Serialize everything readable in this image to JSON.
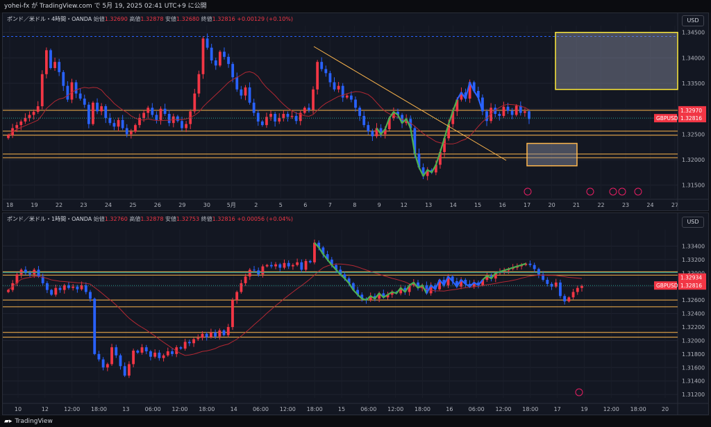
{
  "header": {
    "caption": "yohei-fx が TradingView.com で 5月 19, 2025 02:41 UTC+9 に公開"
  },
  "footer": {
    "brand": "TradingView"
  },
  "colors": {
    "up": "#f23645",
    "down": "#2962ff",
    "zone": "#ffb74d",
    "wave_green": "#4caf50",
    "wave_blue": "#2962ff",
    "ma": "#b22833",
    "price_tag": "#f23645"
  },
  "chart_data": [
    {
      "type": "candlestick",
      "pane": "top",
      "legend": {
        "symbol": "ポンド／米ドル・4時間・OANDA",
        "open_label": "始値",
        "open": "1.32690",
        "high_label": "高値",
        "high": "1.32878",
        "low_label": "安値",
        "low": "1.32680",
        "close_label": "終値",
        "close": "1.32816",
        "change": "+0.00129 (+0.10%)"
      },
      "currency": "USD",
      "ylim": [
        1.3125,
        1.3455
      ],
      "y_ticks": [
        "1.34500",
        "1.34000",
        "1.33500",
        "1.33000",
        "1.32500",
        "1.32000",
        "1.31500"
      ],
      "x_ticks": [
        "18",
        "19",
        "22",
        "23",
        "24",
        "25",
        "26",
        "29",
        "30",
        "5月",
        "2",
        "5",
        "6",
        "7",
        "8",
        "9",
        "12",
        "13",
        "14",
        "15",
        "16",
        "17",
        "20",
        "21",
        "22",
        "23",
        "24",
        "27"
      ],
      "price_labels": [
        {
          "label": "",
          "value": "1.32970"
        },
        {
          "label": "GBPUSD",
          "value": "1.32816"
        }
      ],
      "levels": [
        1.3297,
        1.3256,
        1.3248,
        1.3211,
        1.3204
      ],
      "closes": [
        1.3248,
        1.3262,
        1.3268,
        1.3275,
        1.3282,
        1.3288,
        1.3294,
        1.3305,
        1.3368,
        1.3415,
        1.338,
        1.3392,
        1.3372,
        1.3345,
        1.3318,
        1.3352,
        1.333,
        1.332,
        1.3308,
        1.327,
        1.3312,
        1.3295,
        1.3305,
        1.3282,
        1.3272,
        1.3265,
        1.3278,
        1.3262,
        1.325,
        1.3255,
        1.3268,
        1.3282,
        1.3292,
        1.3302,
        1.3288,
        1.3278,
        1.33,
        1.329,
        1.3272,
        1.3285,
        1.3276,
        1.3262,
        1.327,
        1.3295,
        1.333,
        1.3368,
        1.3438,
        1.342,
        1.3395,
        1.3385,
        1.3412,
        1.3402,
        1.3388,
        1.3362,
        1.3338,
        1.3326,
        1.3342,
        1.3312,
        1.3292,
        1.3275,
        1.3268,
        1.3284,
        1.329,
        1.3275,
        1.3282,
        1.329,
        1.3284,
        1.3286,
        1.3276,
        1.3292,
        1.3302,
        1.3298,
        1.3338,
        1.3392,
        1.3378,
        1.337,
        1.3352,
        1.3338,
        1.3345,
        1.3322,
        1.3326,
        1.3318,
        1.3302,
        1.3286,
        1.3268,
        1.3256,
        1.3246,
        1.3262,
        1.325,
        1.326,
        1.3282,
        1.3294,
        1.3288,
        1.3272,
        1.328,
        1.3262,
        1.3212,
        1.3185,
        1.3168,
        1.318,
        1.3175,
        1.319,
        1.3215,
        1.3242,
        1.327,
        1.3295,
        1.3318,
        1.3332,
        1.332,
        1.3352,
        1.3335,
        1.3322,
        1.3295,
        1.3276,
        1.3302,
        1.329,
        1.3286,
        1.3304,
        1.3296,
        1.3288,
        1.3306,
        1.3292,
        1.3295,
        1.328
      ],
      "annotations": [
        "trendline",
        "green wave",
        "blue wave",
        "supply zone box",
        "demand zone box"
      ],
      "events": [
        "17",
        "21",
        "22",
        "23",
        "24"
      ]
    },
    {
      "type": "candlestick",
      "pane": "bottom",
      "legend": {
        "symbol": "ポンド／米ドル・1時間・OANDA",
        "open_label": "始値",
        "open": "1.32760",
        "high_label": "高値",
        "high": "1.32878",
        "low_label": "安値",
        "low": "1.32753",
        "close_label": "終値",
        "close": "1.32816",
        "change": "+0.00056 (+0.04%)"
      },
      "currency": "USD",
      "ylim": [
        1.3115,
        1.3358
      ],
      "y_ticks": [
        "1.33400",
        "1.33200",
        "1.33000",
        "1.32800",
        "1.32600",
        "1.32400",
        "1.32200",
        "1.32000",
        "1.31800",
        "1.31600",
        "1.31400",
        "1.31200"
      ],
      "x_ticks": [
        "10",
        "12",
        "12:00",
        "18:00",
        "13",
        "06:00",
        "12:00",
        "18:00",
        "14",
        "06:00",
        "12:00",
        "18:00",
        "15",
        "06:00",
        "12:00",
        "18:00",
        "16",
        "06:00",
        "12:00",
        "18:00",
        "17",
        "19",
        "12:00",
        "18:00",
        "20"
      ],
      "price_labels": [
        {
          "label": "",
          "value": "1.32934"
        },
        {
          "label": "GBPUSD",
          "value": "1.32816"
        }
      ],
      "levels": [
        1.3302,
        1.3297,
        1.326,
        1.325,
        1.3212,
        1.3205
      ],
      "closes": [
        1.3275,
        1.3285,
        1.3298,
        1.3305,
        1.33,
        1.3298,
        1.3305,
        1.3295,
        1.3285,
        1.3275,
        1.3268,
        1.3278,
        1.3275,
        1.3282,
        1.3278,
        1.328,
        1.3276,
        1.3282,
        1.3272,
        1.3262,
        1.318,
        1.3172,
        1.316,
        1.3165,
        1.319,
        1.3178,
        1.3162,
        1.3148,
        1.3165,
        1.3185,
        1.3182,
        1.319,
        1.3184,
        1.3176,
        1.3182,
        1.3174,
        1.3178,
        1.3184,
        1.318,
        1.319,
        1.3188,
        1.3198,
        1.3196,
        1.3202,
        1.3204,
        1.321,
        1.3205,
        1.3212,
        1.3206,
        1.3215,
        1.3208,
        1.322,
        1.326,
        1.3272,
        1.3285,
        1.3295,
        1.3305,
        1.3304,
        1.3298,
        1.331,
        1.3312,
        1.331,
        1.3313,
        1.3308,
        1.3315,
        1.331,
        1.3312,
        1.3316,
        1.3305,
        1.3318,
        1.3316,
        1.3345,
        1.3338,
        1.3328,
        1.332,
        1.3312,
        1.3305,
        1.3298,
        1.3292,
        1.3285,
        1.3275,
        1.3268,
        1.3262,
        1.326,
        1.3266,
        1.3262,
        1.327,
        1.3264,
        1.3268,
        1.3272,
        1.327,
        1.3278,
        1.3272,
        1.3282,
        1.3286,
        1.3278,
        1.3282,
        1.327,
        1.3282,
        1.3276,
        1.329,
        1.3282,
        1.3295,
        1.3288,
        1.328,
        1.329,
        1.3284,
        1.328,
        1.3286,
        1.3282,
        1.329,
        1.3296,
        1.3292,
        1.33,
        1.3302,
        1.3304,
        1.3306,
        1.3308,
        1.331,
        1.3312,
        1.3314,
        1.3312,
        1.3306,
        1.3298,
        1.329,
        1.3284,
        1.328,
        1.3286,
        1.3266,
        1.3258,
        1.3264,
        1.3272,
        1.3278,
        1.3281
      ],
      "annotations": [
        "green wave",
        "blue wave"
      ],
      "events": [
        "19"
      ]
    }
  ]
}
